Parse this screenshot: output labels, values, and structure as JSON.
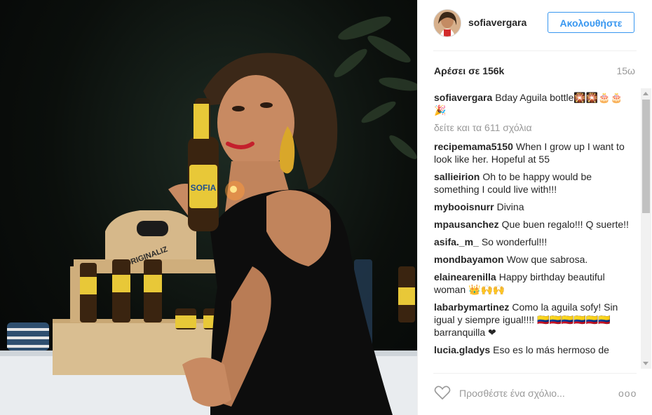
{
  "post": {
    "username": "sofiavergara",
    "follow_label": "Ακολουθήστε",
    "likes": "Αρέσει σε 156k",
    "time": "15ω",
    "caption": {
      "user": "sofiavergara",
      "text": "Bday Aguila bottle🎇🎇🎂🎂 🎉"
    },
    "view_all": "δείτε και τα 611 σχόλια",
    "comments": [
      {
        "user": "recipemama5150",
        "text": "When I grow up I want to look like her. Hopeful at 55"
      },
      {
        "user": "sallieirion",
        "text": "Oh to be happy would be something I could live with!!!"
      },
      {
        "user": "mybooisnurr",
        "text": "Divina"
      },
      {
        "user": "mpausanchez",
        "text": "Que buen regalo!!! Q suerte!!"
      },
      {
        "user": "asifa._m_",
        "text": "So wonderful!!!"
      },
      {
        "user": "mondbayamon",
        "text": "Wow que sabrosa."
      },
      {
        "user": "elainearenilla",
        "text": "Happy birthday beautiful woman 👑🙌🙌"
      },
      {
        "user": "labarbymartinez",
        "text": "Como la aguila sofy! Sin igual y siempre igual!!!! 🇨🇴🇨🇴🇨🇴🇨🇴🇨🇴🇨🇴 barranquilla ❤"
      },
      {
        "user": "lucia.gladys",
        "text": "Eso es lo más hermoso de"
      }
    ],
    "comment_placeholder": "Προσθέστε ένα σχόλιο...",
    "more_label": "ooo"
  },
  "photo": {
    "bottle_label": "SOFIA",
    "crate_label": "ORIGINALIZ"
  },
  "icons": {
    "like": "heart-icon",
    "more": "more-options-icon"
  },
  "colors": {
    "accent": "#3897f0",
    "muted": "#999999"
  }
}
